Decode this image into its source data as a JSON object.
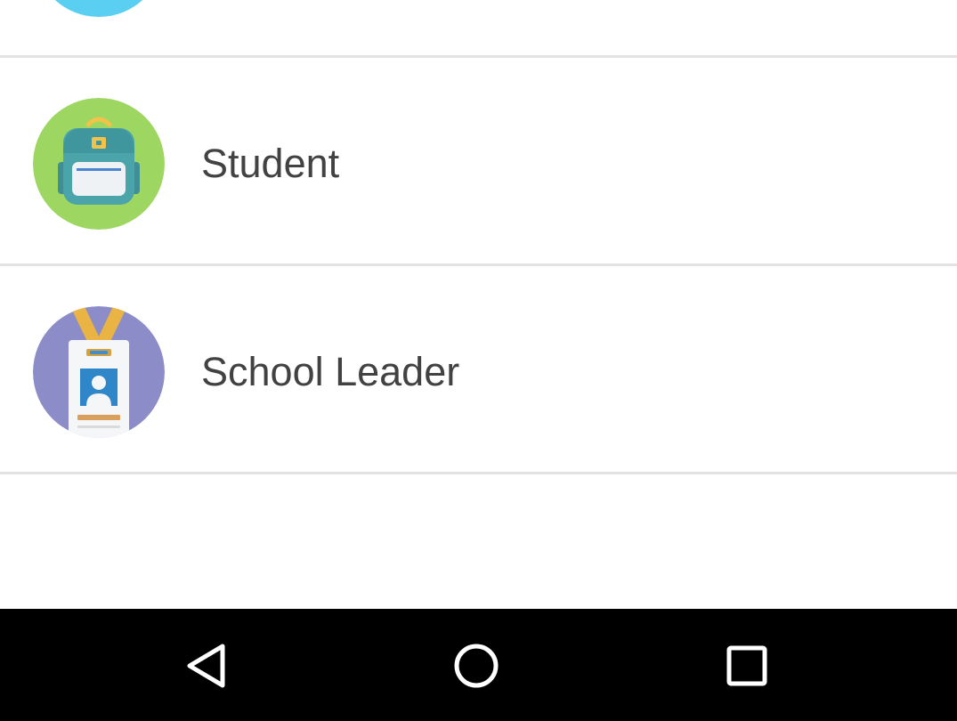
{
  "colors": {
    "background": "#ffffff",
    "divider": "#e2e2e2",
    "label_text": "#424242",
    "partial_avatar": "#5bcff2",
    "student_avatar": "#9dd660",
    "school_leader_avatar": "#8c8cc8",
    "navbar": "#000000",
    "nav_icon": "#ffffff"
  },
  "role_list": {
    "items": [
      {
        "label": "Student",
        "icon": "backpack-icon"
      },
      {
        "label": "School Leader",
        "icon": "id-badge-icon"
      }
    ]
  },
  "navigation_bar": {
    "back": {
      "icon": "back-triangle-icon"
    },
    "home": {
      "icon": "home-circle-icon"
    },
    "recents": {
      "icon": "recents-square-icon"
    }
  }
}
